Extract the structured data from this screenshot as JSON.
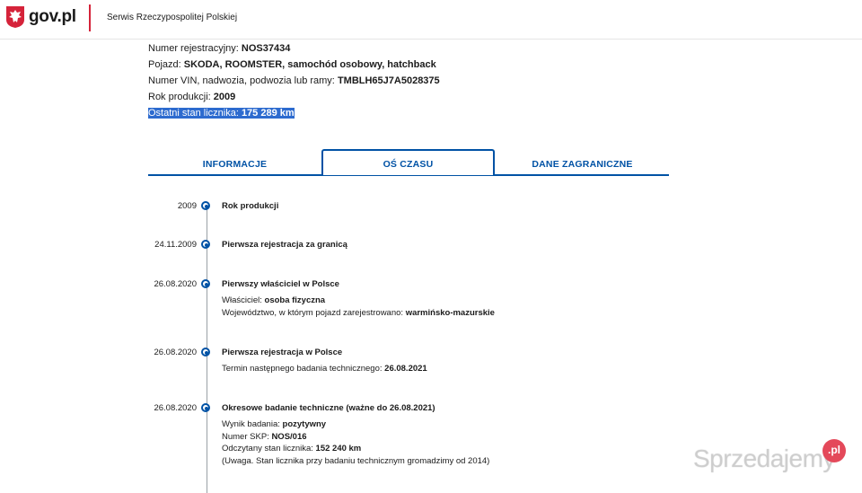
{
  "header": {
    "logo_text": "gov.pl",
    "service_name": "Serwis Rzeczypospolitej Polskiej"
  },
  "vehicle": {
    "registration": {
      "label": "Numer rejestracyjny:",
      "value": "NOS37434"
    },
    "vehicle": {
      "label": "Pojazd:",
      "value": "SKODA, ROOMSTER, samochód osobowy, hatchback"
    },
    "vin": {
      "label": "Numer VIN, nadwozia, podwozia lub ramy:",
      "value": "TMBLH65J7A5028375"
    },
    "year": {
      "label": "Rok produkcji:",
      "value": "2009"
    },
    "odometer": {
      "label": "Ostatni stan licznika:",
      "value": "175 289 km"
    }
  },
  "tabs": [
    {
      "label": "INFORMACJE",
      "active": false
    },
    {
      "label": "OŚ CZASU",
      "active": true
    },
    {
      "label": "DANE ZAGRANICZNE",
      "active": false
    }
  ],
  "timeline": [
    {
      "date": "2009",
      "title": "Rok produkcji",
      "details": []
    },
    {
      "date": "24.11.2009",
      "title": "Pierwsza rejestracja za granicą",
      "details": []
    },
    {
      "date": "26.08.2020",
      "title": "Pierwszy właściciel w Polsce",
      "details": [
        {
          "label": "Właściciel:",
          "value": "osoba fizyczna"
        },
        {
          "label": "Województwo, w którym pojazd zarejestrowano:",
          "value": "warmińsko-mazurskie"
        }
      ]
    },
    {
      "date": "26.08.2020",
      "title": "Pierwsza rejestracja w Polsce",
      "details": [
        {
          "label": "Termin następnego badania technicznego:",
          "value": "26.08.2021"
        }
      ]
    },
    {
      "date": "26.08.2020",
      "title": "Okresowe badanie techniczne (ważne do 26.08.2021)",
      "details": [
        {
          "label": "Wynik badania:",
          "value": "pozytywny"
        },
        {
          "label": "Numer SKP:",
          "value": "NOS/016"
        },
        {
          "label": "Odczytany stan licznika:",
          "value": "152 240 km"
        },
        {
          "label": "(Uwaga. Stan licznika przy badaniu technicznym gromadzimy od 2014)",
          "value": ""
        }
      ]
    }
  ],
  "watermark": {
    "text": "Sprzedajemy",
    "badge": ".pl"
  },
  "colors": {
    "accent": "#0052a5",
    "brand_red": "#d5233a",
    "selection": "#2d6bcf"
  }
}
